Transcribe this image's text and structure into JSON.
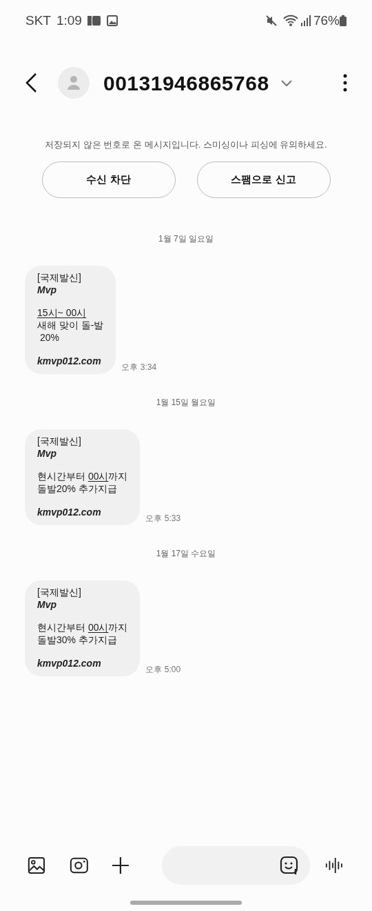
{
  "status_bar": {
    "carrier": "SKT",
    "time": "1:09",
    "battery": "76%"
  },
  "header": {
    "title": "00131946865768"
  },
  "notice": {
    "text": "저장되지 않은 번호로 온 메시지입니다. 스미싱이나 피싱에 유의하세요.",
    "buttons": [
      "수신 차단",
      "스팸으로 신고"
    ]
  },
  "conversation": [
    {
      "date": "1월 7일 일요일",
      "header": "[국제발신]",
      "sender": "Mvp",
      "body": [
        [
          {
            "text": "15시~ 00시",
            "underlined": true
          }
        ],
        [
          {
            "text": "새해 맞이 돌-발",
            "underlined": false
          }
        ],
        [
          {
            "text": " 20%",
            "underlined": false
          }
        ]
      ],
      "link": "kmvp012.com",
      "time": "오후 3:34"
    },
    {
      "date": "1월 15일 월요일",
      "header": "[국제발신]",
      "sender": "Mvp",
      "body": [
        [
          {
            "text": "현시간부터 ",
            "underlined": false
          },
          {
            "text": "00시",
            "underlined": true
          },
          {
            "text": "까지",
            "underlined": false
          }
        ],
        [
          {
            "text": "돌발20% 추가지급",
            "underlined": false
          }
        ]
      ],
      "link": "kmvp012.com",
      "time": "오후 5:33"
    },
    {
      "date": "1월 17일 수요일",
      "header": "[국제발신]",
      "sender": "Mvp",
      "body": [
        [
          {
            "text": "현시간부터 ",
            "underlined": false
          },
          {
            "text": "00시",
            "underlined": true
          },
          {
            "text": "까지",
            "underlined": false
          }
        ],
        [
          {
            "text": "돌발30% 추가지급",
            "underlined": false
          }
        ]
      ],
      "link": "kmvp012.com",
      "time": "오후 5:00"
    }
  ]
}
